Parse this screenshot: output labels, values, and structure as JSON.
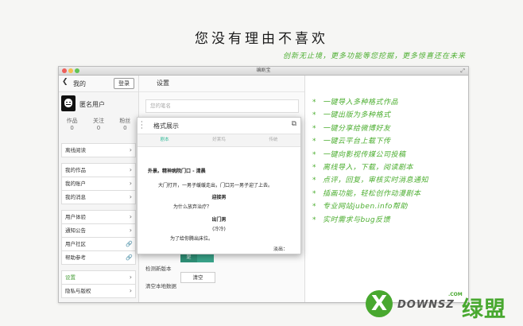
{
  "headline": "您没有理由不喜欢",
  "subline": "创新无止境，更多功能等您挖掘，更多惊喜还在未来",
  "window": {
    "title": "编剧宝"
  },
  "sidebar": {
    "title": "我的",
    "login_button": "登录",
    "user_name": "匿名用户",
    "stats": [
      {
        "label": "作品",
        "value": "0"
      },
      {
        "label": "关注",
        "value": "0"
      },
      {
        "label": "粉丝",
        "value": "0"
      }
    ],
    "groups": [
      [
        {
          "label": "离线阅读",
          "icon": "chevron"
        }
      ],
      [
        {
          "label": "我的作品",
          "icon": "chevron"
        },
        {
          "label": "我的账户",
          "icon": "chevron"
        },
        {
          "label": "我的消息",
          "icon": "chevron"
        }
      ],
      [
        {
          "label": "用户体验",
          "icon": "chevron"
        },
        {
          "label": "通知公告",
          "icon": "chevron"
        },
        {
          "label": "用户社区",
          "icon": "link"
        },
        {
          "label": "帮助参考",
          "icon": "link"
        }
      ],
      [
        {
          "label": "设置",
          "icon": "chevron",
          "active": true
        },
        {
          "label": "隐私与版权",
          "icon": "chevron"
        }
      ]
    ]
  },
  "settings": {
    "title": "设置",
    "pen_name_placeholder": "您的笔名",
    "check_version_label": "检测新版本",
    "toggle_value": "是",
    "clear_data_label": "清空本地数据",
    "clear_button": "清空"
  },
  "popup": {
    "title": "格式展示",
    "tabs": [
      "剧本",
      "好莱坞",
      "传统"
    ],
    "active_tab": 0,
    "script": {
      "scene": "外景。精神病院门口 - 清晨",
      "action": "大门打开，一男子缓缓走出，门口另一男子迎了上去。",
      "char1": "迎接男",
      "line1": "为什么放弃治疗？",
      "char2": "出门男",
      "paren": "(冷冷)",
      "line2": "为了给你腾出床位。",
      "transition": "淡出："
    }
  },
  "features": [
    "一键导入多种格式作品",
    "一键出版为多种格式",
    "一键分享给微博好友",
    "一键云平台上载下传",
    "一键向影视传媒公司投稿",
    "离线导入，下载，阅读剧本",
    "点评，回复，审核实时消息通知",
    "插画功能，轻松创作动漫剧本",
    "专业网站juben.info帮助",
    "实时需求与bug反馈"
  ],
  "watermark": {
    "brand": "DOWNSZ",
    "domain": ".COM",
    "cn": "绿盟",
    "letter": "X"
  },
  "colors": {
    "accent": "#4cae30",
    "toggle": "#3aa48a"
  }
}
